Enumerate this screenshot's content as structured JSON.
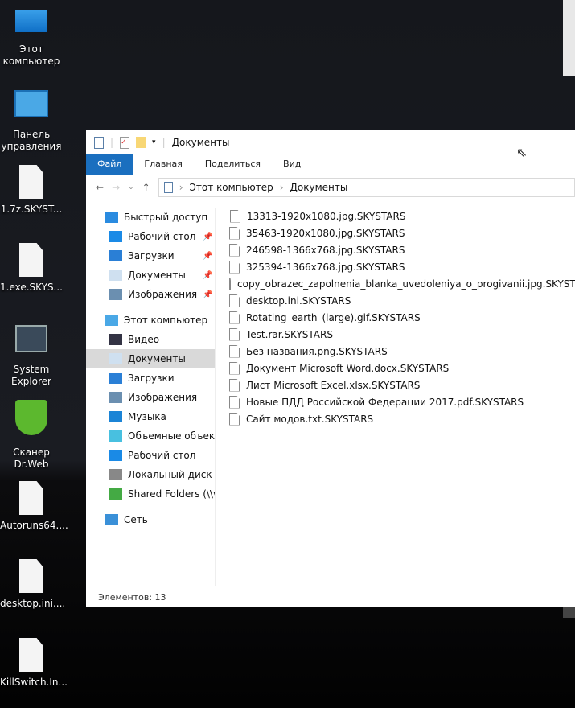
{
  "desktop": {
    "icons": [
      {
        "label": "Этот\nкомпьютер",
        "icon": "computer-icon"
      },
      {
        "label": "Панель\nуправления",
        "icon": "control-panel-icon"
      },
      {
        "label": "1.7z.SKYST...",
        "icon": "file-icon"
      },
      {
        "label": "1.exe.SKYS...",
        "icon": "file-icon"
      },
      {
        "label": "System\nExplorer",
        "icon": "system-explorer-icon"
      },
      {
        "label": "Сканер\nDr.Web",
        "icon": "drweb-icon"
      },
      {
        "label": "Autoruns64....",
        "icon": "file-icon"
      },
      {
        "label": "desktop.ini....",
        "icon": "file-icon"
      },
      {
        "label": "KillSwitch.In...",
        "icon": "file-icon"
      }
    ]
  },
  "window": {
    "title": "Документы",
    "ribbon_tabs": [
      "Файл",
      "Главная",
      "Поделиться",
      "Вид"
    ],
    "breadcrumb": [
      "Этот компьютер",
      "Документы"
    ],
    "nav": [
      {
        "label": "Быстрый доступ",
        "icon": "star-icon",
        "level": 0
      },
      {
        "label": "Рабочий стол",
        "icon": "desktop-icon",
        "level": 1,
        "pinned": true
      },
      {
        "label": "Загрузки",
        "icon": "download-icon",
        "level": 1,
        "pinned": true
      },
      {
        "label": "Документы",
        "icon": "documents-icon",
        "level": 1,
        "pinned": true
      },
      {
        "label": "Изображения",
        "icon": "pictures-icon",
        "level": 1,
        "pinned": true
      },
      {
        "label": "Этот компьютер",
        "icon": "computer-icon",
        "level": 0
      },
      {
        "label": "Видео",
        "icon": "video-icon",
        "level": 1
      },
      {
        "label": "Документы",
        "icon": "documents-icon",
        "level": 1,
        "selected": true
      },
      {
        "label": "Загрузки",
        "icon": "download-icon",
        "level": 1
      },
      {
        "label": "Изображения",
        "icon": "pictures-icon",
        "level": 1
      },
      {
        "label": "Музыка",
        "icon": "music-icon",
        "level": 1
      },
      {
        "label": "Объемные объекты",
        "icon": "3d-objects-icon",
        "level": 1
      },
      {
        "label": "Рабочий стол",
        "icon": "desktop-icon",
        "level": 1
      },
      {
        "label": "Локальный диск (C:)",
        "icon": "drive-icon",
        "level": 1
      },
      {
        "label": "Shared Folders (\\\\vmware-host)",
        "icon": "network-drive-icon",
        "level": 1
      },
      {
        "label": "Сеть",
        "icon": "network-icon",
        "level": 0
      }
    ],
    "files": [
      "13313-1920x1080.jpg.SKYSTARS",
      "35463-1920x1080.jpg.SKYSTARS",
      "246598-1366x768.jpg.SKYSTARS",
      "325394-1366x768.jpg.SKYSTARS",
      "copy_obrazec_zapolnenia_blanka_uvedoleniya_o_progivanii.jpg.SKYSTARS",
      "desktop.ini.SKYSTARS",
      "Rotating_earth_(large).gif.SKYSTARS",
      "Test.rar.SKYSTARS",
      "Без названия.png.SKYSTARS",
      "Документ Microsoft Word.docx.SKYSTARS",
      "Лист Microsoft Excel.xlsx.SKYSTARS",
      "Новые ПДД Российской Федерации 2017.pdf.SKYSTARS",
      "Сайт модов.txt.SKYSTARS"
    ],
    "status": "Элементов: 13"
  },
  "colors": {
    "accent": "#1a6fbf"
  }
}
